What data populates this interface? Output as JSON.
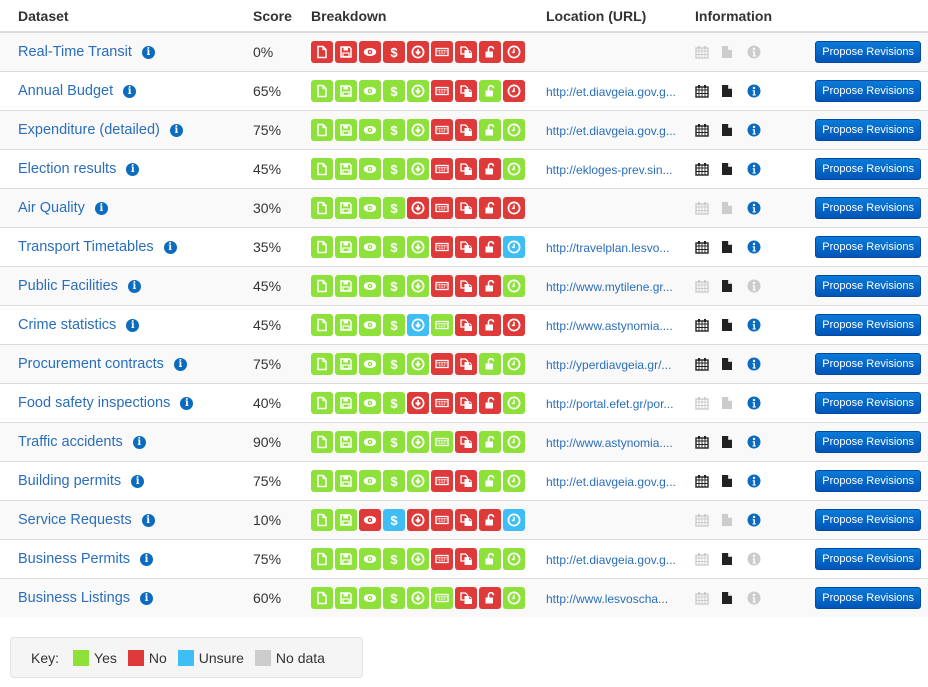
{
  "table": {
    "headers": {
      "dataset": "Dataset",
      "score": "Score",
      "breakdown": "Breakdown",
      "location": "Location (URL)",
      "information": "Information"
    },
    "breakdown_criteria": [
      {
        "key": "digital",
        "icon": "file-icon"
      },
      {
        "key": "machine_readable",
        "icon": "save-icon"
      },
      {
        "key": "public",
        "icon": "eye-icon"
      },
      {
        "key": "free",
        "icon": "dollar-icon"
      },
      {
        "key": "online",
        "icon": "download-icon"
      },
      {
        "key": "bulk",
        "icon": "keyboard-icon"
      },
      {
        "key": "open_license",
        "icon": "copy-icon"
      },
      {
        "key": "open",
        "icon": "unlock-icon"
      },
      {
        "key": "up_to_date",
        "icon": "clock-icon"
      }
    ],
    "rows": [
      {
        "name": "Real-Time Transit",
        "score": "0%",
        "breakdown": [
          "no",
          "no",
          "no",
          "no",
          "no",
          "no",
          "no",
          "no",
          "no"
        ],
        "url": "",
        "info": {
          "calendar": "off",
          "document": "off",
          "details": "off"
        }
      },
      {
        "name": "Annual Budget",
        "score": "65%",
        "breakdown": [
          "yes",
          "yes",
          "yes",
          "yes",
          "yes",
          "no",
          "no",
          "yes",
          "no"
        ],
        "url": "http://et.diavgeia.gov.g...",
        "info": {
          "calendar": "on",
          "document": "on",
          "details": "on"
        }
      },
      {
        "name": "Expenditure (detailed)",
        "score": "75%",
        "breakdown": [
          "yes",
          "yes",
          "yes",
          "yes",
          "yes",
          "no",
          "no",
          "yes",
          "yes"
        ],
        "url": "http://et.diavgeia.gov.g...",
        "info": {
          "calendar": "on",
          "document": "on",
          "details": "on"
        }
      },
      {
        "name": "Election results",
        "score": "45%",
        "breakdown": [
          "yes",
          "yes",
          "yes",
          "yes",
          "yes",
          "no",
          "no",
          "no",
          "yes"
        ],
        "url": "http://ekloges-prev.sin...",
        "info": {
          "calendar": "on",
          "document": "on",
          "details": "on"
        }
      },
      {
        "name": "Air Quality",
        "score": "30%",
        "breakdown": [
          "yes",
          "yes",
          "yes",
          "yes",
          "no",
          "no",
          "no",
          "no",
          "no"
        ],
        "url": "",
        "info": {
          "calendar": "off",
          "document": "off",
          "details": "on"
        }
      },
      {
        "name": "Transport Timetables",
        "score": "35%",
        "breakdown": [
          "yes",
          "yes",
          "yes",
          "yes",
          "yes",
          "no",
          "no",
          "no",
          "unsure"
        ],
        "url": "http://travelplan.lesvo...",
        "info": {
          "calendar": "on",
          "document": "on",
          "details": "on"
        }
      },
      {
        "name": "Public Facilities",
        "score": "45%",
        "breakdown": [
          "yes",
          "yes",
          "yes",
          "yes",
          "yes",
          "no",
          "no",
          "no",
          "yes"
        ],
        "url": "http://www.mytilene.gr...",
        "info": {
          "calendar": "off",
          "document": "on",
          "details": "off"
        }
      },
      {
        "name": "Crime statistics",
        "score": "45%",
        "breakdown": [
          "yes",
          "yes",
          "yes",
          "yes",
          "unsure",
          "yes",
          "no",
          "no",
          "no"
        ],
        "url": "http://www.astynomia....",
        "info": {
          "calendar": "on",
          "document": "on",
          "details": "on"
        }
      },
      {
        "name": "Procurement contracts",
        "score": "75%",
        "breakdown": [
          "yes",
          "yes",
          "yes",
          "yes",
          "yes",
          "no",
          "no",
          "yes",
          "yes"
        ],
        "url": "http://yperdiavgeia.gr/...",
        "info": {
          "calendar": "on",
          "document": "on",
          "details": "on"
        }
      },
      {
        "name": "Food safety inspections",
        "score": "40%",
        "breakdown": [
          "yes",
          "yes",
          "yes",
          "yes",
          "no",
          "no",
          "no",
          "no",
          "yes"
        ],
        "url": "http://portal.efet.gr/por...",
        "info": {
          "calendar": "off",
          "document": "off",
          "details": "on"
        }
      },
      {
        "name": "Traffic accidents",
        "score": "90%",
        "breakdown": [
          "yes",
          "yes",
          "yes",
          "yes",
          "yes",
          "yes",
          "no",
          "yes",
          "yes"
        ],
        "url": "http://www.astynomia....",
        "info": {
          "calendar": "on",
          "document": "on",
          "details": "on"
        }
      },
      {
        "name": "Building permits",
        "score": "75%",
        "breakdown": [
          "yes",
          "yes",
          "yes",
          "yes",
          "yes",
          "no",
          "no",
          "yes",
          "yes"
        ],
        "url": "http://et.diavgeia.gov.g...",
        "info": {
          "calendar": "on",
          "document": "on",
          "details": "on"
        }
      },
      {
        "name": "Service Requests",
        "score": "10%",
        "breakdown": [
          "yes",
          "yes",
          "no",
          "unsure",
          "no",
          "no",
          "no",
          "no",
          "unsure"
        ],
        "url": "",
        "info": {
          "calendar": "off",
          "document": "off",
          "details": "on"
        }
      },
      {
        "name": "Business Permits",
        "score": "75%",
        "breakdown": [
          "yes",
          "yes",
          "yes",
          "yes",
          "yes",
          "no",
          "no",
          "yes",
          "yes"
        ],
        "url": "http://et.diavgeia.gov.g...",
        "info": {
          "calendar": "off",
          "document": "on",
          "details": "off"
        }
      },
      {
        "name": "Business Listings",
        "score": "60%",
        "breakdown": [
          "yes",
          "yes",
          "yes",
          "yes",
          "yes",
          "yes",
          "no",
          "no",
          "yes"
        ],
        "url": "http://www.lesvoscha...",
        "info": {
          "calendar": "off",
          "document": "on",
          "details": "off"
        }
      }
    ],
    "action_label": "Propose Revisions",
    "info_glyph": "i"
  },
  "legend": {
    "label": "Key:",
    "items": [
      {
        "status": "yes",
        "label": "Yes",
        "color": "#8ee13a"
      },
      {
        "status": "no",
        "label": "No",
        "color": "#de3a3a"
      },
      {
        "status": "unsure",
        "label": "Unsure",
        "color": "#3ebef5"
      },
      {
        "status": "nodata",
        "label": "No data",
        "color": "#cccccc"
      }
    ]
  },
  "colors": {
    "link": "#2a6ebb",
    "info_blue": "#0a6bbf",
    "icon_on": "#222222",
    "icon_off": "#cccccc",
    "button": "#0a6fd0"
  }
}
